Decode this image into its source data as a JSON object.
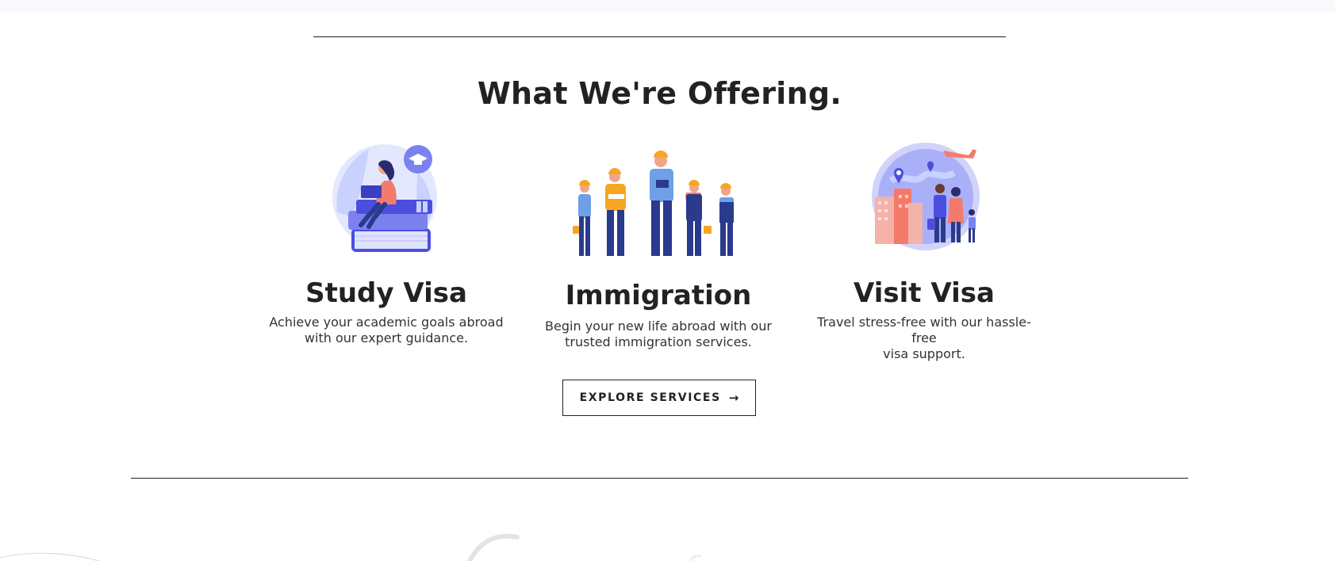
{
  "section": {
    "title": "What We're Offering."
  },
  "cards": [
    {
      "title": "Study Visa",
      "description": [
        "Achieve your academic goals abroad",
        "with our expert guidance."
      ],
      "icon": "student-on-books-illustration"
    },
    {
      "title": "Immigration",
      "description": [
        "Begin your new life abroad with our",
        "trusted immigration services."
      ],
      "icon": "workers-group-illustration"
    },
    {
      "title": "Visit Visa",
      "description": [
        "Travel stress-free with our hassle-free",
        "visa support."
      ],
      "icon": "family-travel-globe-illustration"
    }
  ],
  "cta": {
    "label": "EXPLORE SERVICES",
    "icon": "arrow-right-icon",
    "arrow": "→"
  },
  "colors": {
    "text": "#222222",
    "accent_blue": "#5b5fe8",
    "light_blue": "#dfe4ff",
    "coral": "#f27b6b",
    "navy": "#2a3a8c",
    "yellow": "#f6a623"
  }
}
